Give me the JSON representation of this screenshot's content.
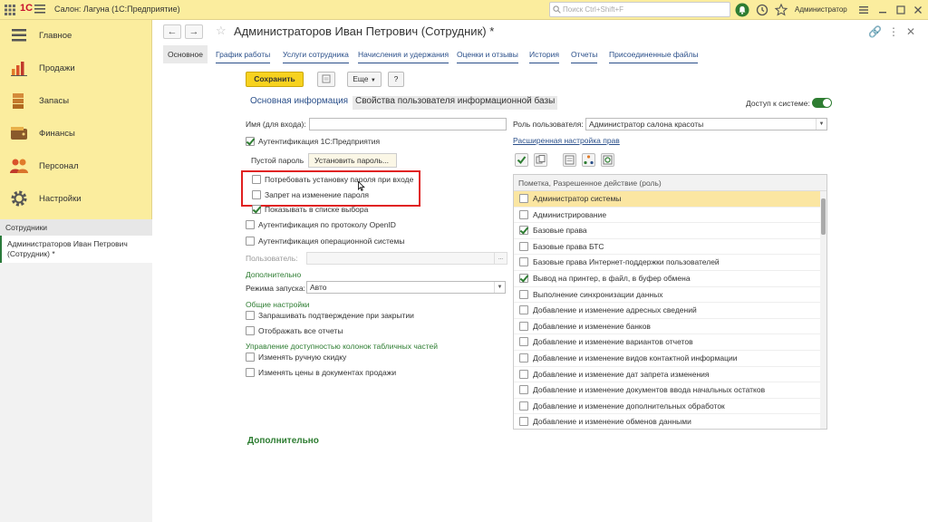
{
  "app": {
    "logo": "1С",
    "title": "Салон: Лагуна  (1С:Предприятие)",
    "search_placeholder": "Поиск Ctrl+Shift+F",
    "user": "Администратор"
  },
  "sidebar": {
    "items": [
      {
        "label": "Главное",
        "icon": "menu-lines-icon"
      },
      {
        "label": "Продажи",
        "icon": "chart-icon"
      },
      {
        "label": "Запасы",
        "icon": "boxes-icon"
      },
      {
        "label": "Финансы",
        "icon": "wallet-icon"
      },
      {
        "label": "Персонал",
        "icon": "people-icon"
      },
      {
        "label": "Настройки",
        "icon": "gear-icon"
      }
    ],
    "section": "Сотрудники",
    "open_document": "Администраторов Иван Петрович (Сотрудник) *"
  },
  "document": {
    "title": "Администраторов Иван Петрович (Сотрудник) *",
    "tabs": [
      "Основное",
      "График работы",
      "Услуги сотрудника",
      "Начисления и удержания",
      "Оценки и отзывы",
      "История",
      "Отчеты",
      "Присоединенные файлы"
    ],
    "toolbar": {
      "save": "Сохранить",
      "more": "Еще",
      "help": "?"
    },
    "subtabs": {
      "main_info": "Основная информация",
      "user_props": "Свойства пользователя информационной базы"
    },
    "access_label": "Доступ к системе:"
  },
  "form": {
    "login_label": "Имя (для входа):",
    "login_value": "",
    "auth_1c": "Аутентификация 1С:Предприятия",
    "empty_password": "Пустой пароль",
    "set_password": "Установить пароль...",
    "require_password": "Потребовать установку пароля при входе",
    "forbid_password_change": "Запрет на изменение пароля",
    "show_in_list": "Показывать в списке выбора",
    "auth_openid": "Аутентификация по протоколу OpenID",
    "auth_os": "Аутентификация операционной системы",
    "user_label": "Пользователь:",
    "user_btn": "...",
    "additional": "Дополнительно",
    "launch_mode_label": "Режима запуска:",
    "launch_mode_value": "Авто",
    "general_settings": "Общие настройки",
    "confirm_close": "Запрашивать подтверждение при закрытии",
    "show_all_reports": "Отображать все отчеты",
    "columns_access": "Управление доступностью колонок табличных частей",
    "manual_discount": "Изменять ручную скидку",
    "change_prices": "Изменять цены в документах продажи",
    "bottom_additional": "Дополнительно"
  },
  "rights": {
    "role_label": "Роль пользователя:",
    "role_value": "Администратор салона красоты",
    "advanced_link": "Расширенная настройка прав",
    "table_header": "Пометка, Разрешенное действие (роль)",
    "rows": [
      {
        "label": "Администратор системы",
        "checked": false
      },
      {
        "label": "Администрирование",
        "checked": false
      },
      {
        "label": "Базовые права",
        "checked": true
      },
      {
        "label": "Базовые права БТС",
        "checked": false
      },
      {
        "label": "Базовые права Интернет-поддержки пользователей",
        "checked": false
      },
      {
        "label": "Вывод на принтер, в файл, в буфер обмена",
        "checked": true
      },
      {
        "label": "Выполнение синхронизации данных",
        "checked": false
      },
      {
        "label": "Добавление и изменение адресных сведений",
        "checked": false
      },
      {
        "label": "Добавление и изменение банков",
        "checked": false
      },
      {
        "label": "Добавление и изменение вариантов отчетов",
        "checked": false
      },
      {
        "label": "Добавление и изменение видов контактной информации",
        "checked": false
      },
      {
        "label": "Добавление и изменение дат запрета изменения",
        "checked": false
      },
      {
        "label": "Добавление и изменение документов ввода начальных остатков",
        "checked": false
      },
      {
        "label": "Добавление и изменение дополнительных обработок",
        "checked": false
      },
      {
        "label": "Добавление и изменение обменов данными",
        "checked": false
      }
    ]
  },
  "colors": {
    "accent_yellow": "#fbed9e",
    "save_button": "#f7d21f",
    "link_blue": "#2a4f8a",
    "green": "#2e7d32",
    "highlight": "#e02020"
  }
}
